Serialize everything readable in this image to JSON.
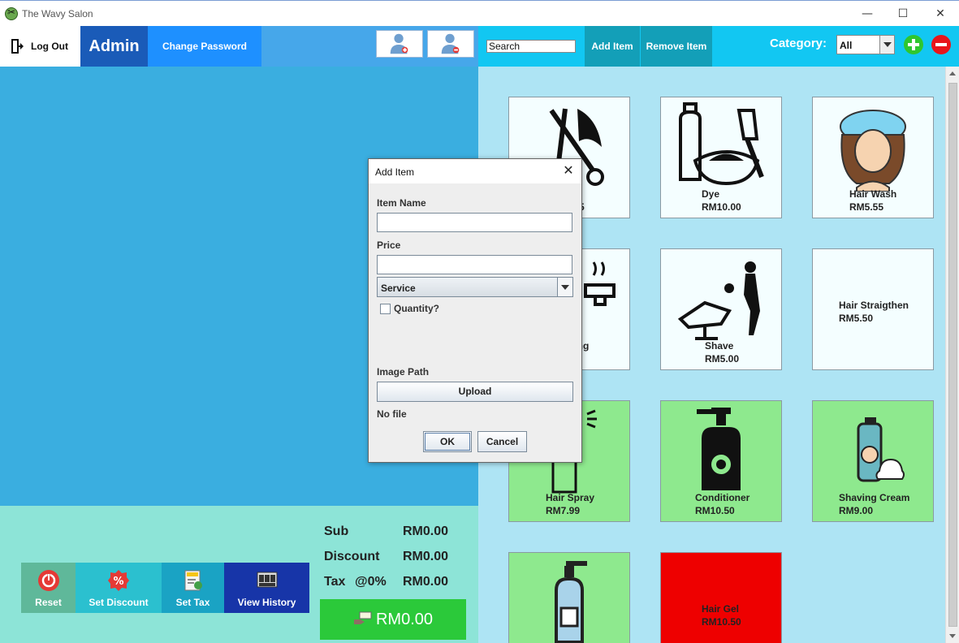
{
  "window": {
    "title": "The Wavy Salon",
    "controls": {
      "minimize": "—",
      "maximize": "☐",
      "close": "✕"
    }
  },
  "topbar": {
    "logout_label": "Log Out",
    "admin_label": "Admin",
    "change_password_label": "Change Password",
    "search_value": "Search",
    "add_item_label": "Add Item",
    "remove_item_label": "Remove Item",
    "category_label": "Category:",
    "category_value": "All"
  },
  "items": [
    {
      "name": "Haircut",
      "price": "RM5.55",
      "visible_name": "nt",
      "visible_price": "5",
      "color": "#f4feff",
      "icon": "scissors-comb-icon"
    },
    {
      "name": "Dye",
      "price": "RM10.00",
      "color": "#f4feff",
      "icon": "dye-bottle-brush-icon"
    },
    {
      "name": "Hair Wash",
      "price": "RM5.55",
      "color": "#f4feff",
      "icon": "hair-wash-icon"
    },
    {
      "name": "Hair Styling",
      "price": "",
      "visible_name": "ling",
      "color": "#f4feff",
      "icon": "hair-dryer-icon"
    },
    {
      "name": "Shave",
      "price": "RM5.00",
      "color": "#f4feff",
      "icon": "barber-chair-icon"
    },
    {
      "name": "Hair Straigthen",
      "price": "RM5.50",
      "color": "#f4feff",
      "icon": ""
    },
    {
      "name": "Hair Spray",
      "price": "RM7.99",
      "color": "#8ee98e",
      "icon": "spray-can-icon"
    },
    {
      "name": "Conditioner",
      "price": "RM10.50",
      "color": "#8ee98e",
      "icon": "pump-bottle-icon"
    },
    {
      "name": "Shaving Cream",
      "price": "RM9.00",
      "color": "#8ee98e",
      "icon": "shaving-cream-icon"
    },
    {
      "name": "",
      "price": "",
      "color": "#8ee98e",
      "icon": "lotion-bottle-icon"
    },
    {
      "name": "Hair Gel",
      "price": "RM10.50",
      "color": "#ee0000",
      "icon": ""
    }
  ],
  "actions": {
    "reset_label": "Reset",
    "set_discount_label": "Set Discount",
    "set_tax_label": "Set Tax",
    "view_history_label": "View History"
  },
  "totals": {
    "sub_label": "Sub",
    "sub_value": "RM0.00",
    "discount_label": "Discount",
    "discount_value": "RM0.00",
    "tax_label": "Tax",
    "tax_rate": "@0%",
    "tax_value": "RM0.00",
    "total_value": "RM0.00"
  },
  "dialog": {
    "title": "Add Item",
    "item_name_label": "Item Name",
    "item_name_value": "",
    "price_label": "Price",
    "price_value": "",
    "type_value": "Service",
    "quantity_label": "Quantity?",
    "image_path_label": "Image Path",
    "upload_label": "Upload",
    "file_status": "No file",
    "ok_label": "OK",
    "cancel_label": "Cancel"
  },
  "colors": {
    "service_card": "#f4feff",
    "product_card": "#8ee98e",
    "out_of_stock_card": "#ee0000",
    "accent_blue": "#1e90ff",
    "pay_green": "#2bc93a"
  }
}
